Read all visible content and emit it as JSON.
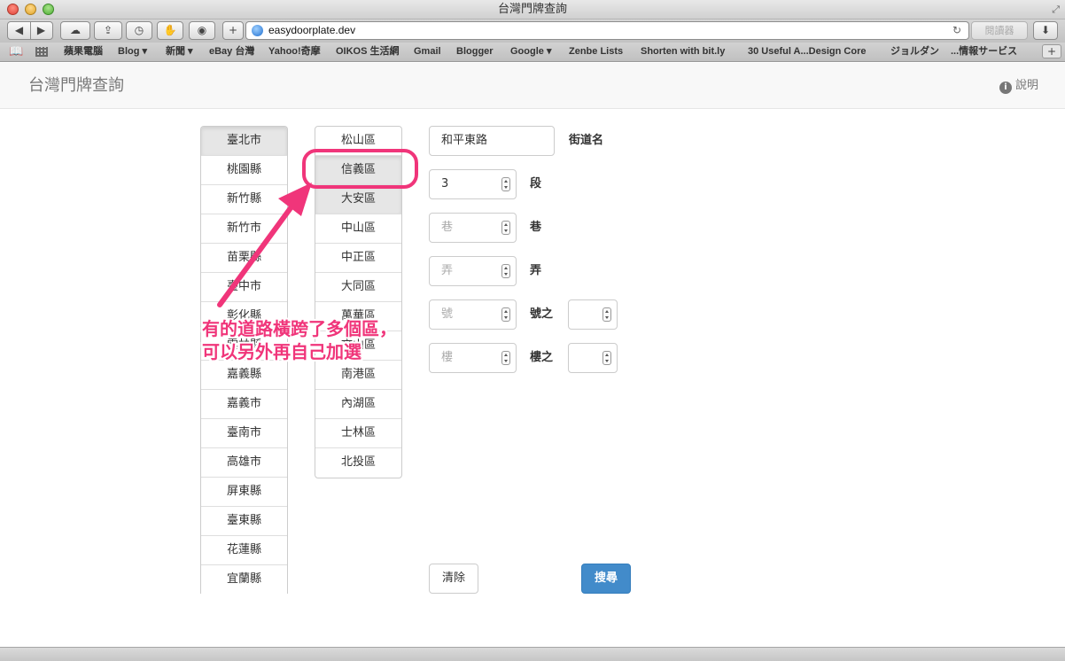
{
  "window": {
    "title": "台灣門牌查詢"
  },
  "toolbar": {
    "back": "◀",
    "forward": "▶",
    "add": "+",
    "url": "easydoorplate.dev",
    "reader_label": "閱讀器",
    "reload_icon": "↻",
    "icons": {
      "icloud": "cloud-icon",
      "share": "share-icon",
      "history": "history-icon",
      "hand": "hand-icon",
      "safe": "ghostery-icon",
      "download": "download-icon"
    }
  },
  "bookmarks": [
    "蘋果電腦",
    "Blog ▾",
    "新聞 ▾",
    "eBay 台灣",
    "Yahoo!奇摩",
    "OIKOS 生活網",
    "Gmail",
    "Blogger",
    "Google ▾",
    "Zenbe Lists",
    "Shorten with bit.ly",
    "30 Useful A...Design Core",
    "ジョルダン",
    "...情報サービス"
  ],
  "header": {
    "brand": "台灣門牌查詢",
    "help": "說明",
    "info_icon": "i"
  },
  "cities": [
    "臺北市",
    "桃園縣",
    "新竹縣",
    "新竹市",
    "苗栗縣",
    "臺中市",
    "彰化縣",
    "雲林縣",
    "嘉義縣",
    "嘉義市",
    "臺南市",
    "高雄市",
    "屏東縣",
    "臺東縣",
    "花蓮縣",
    "宜蘭縣"
  ],
  "districts": [
    "松山區",
    "信義區",
    "大安區",
    "中山區",
    "中正區",
    "大同區",
    "萬華區",
    "文山區",
    "南港區",
    "內湖區",
    "士林區",
    "北投區"
  ],
  "form": {
    "street_value": "和平東路",
    "street_label": "街道名",
    "section_value": "3",
    "section_label": "段",
    "lane_placeholder": "巷",
    "lane_label": "巷",
    "alley_placeholder": "弄",
    "alley_label": "弄",
    "number_placeholder": "號",
    "number_sub_label": "號之",
    "floor_placeholder": "樓",
    "floor_sub_label": "樓之",
    "clear_label": "清除",
    "search_label": "搜尋"
  },
  "annotation": {
    "line1": "有的道路橫跨了多個區，",
    "line2": "可以另外再自己加選",
    "color": "#f0357a"
  },
  "colors": {
    "primary": "#428bca",
    "annotation": "#f0357a"
  }
}
